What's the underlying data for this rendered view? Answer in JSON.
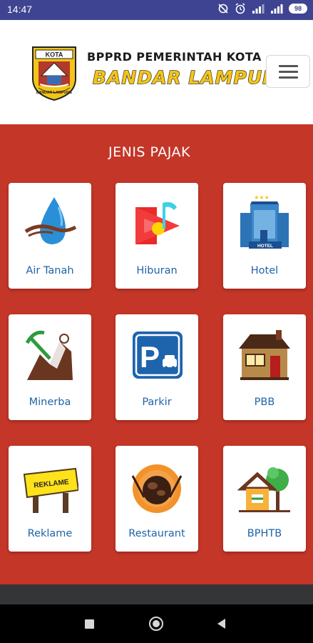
{
  "status_bar": {
    "time": "14:47",
    "battery": "98",
    "icons": [
      "sync-off-icon",
      "alarm-icon",
      "signal-icon",
      "signal-icon",
      "battery-icon"
    ]
  },
  "header": {
    "logo_top_text": "KOTA",
    "logo_bottom_text": "BANDAR LAMPUNG",
    "title_line1": "BPPRD PEMERINTAH KOTA",
    "title_line2": "BANDAR LAMPUNG",
    "menu_icon": "hamburger-menu-icon"
  },
  "main": {
    "section_title": "JENIS PAJAK",
    "tiles": [
      {
        "label": "Air Tanah",
        "icon": "water-drop-icon"
      },
      {
        "label": "Hiburan",
        "icon": "entertainment-play-icon"
      },
      {
        "label": "Hotel",
        "icon": "hotel-building-icon",
        "icon_text": "HOTEL"
      },
      {
        "label": "Minerba",
        "icon": "mining-icon"
      },
      {
        "label": "Parkir",
        "icon": "parking-icon",
        "icon_text": "P"
      },
      {
        "label": "PBB",
        "icon": "house-icon"
      },
      {
        "label": "Reklame",
        "icon": "billboard-icon",
        "icon_text": "REKLAME"
      },
      {
        "label": "Restaurant",
        "icon": "restaurant-icon"
      },
      {
        "label": "BPHTB",
        "icon": "land-building-icon"
      }
    ]
  },
  "colors": {
    "status_bar": "#3e4491",
    "content_background": "#c43628",
    "label_blue": "#1f63a8",
    "brand_yellow": "#f4c516"
  }
}
